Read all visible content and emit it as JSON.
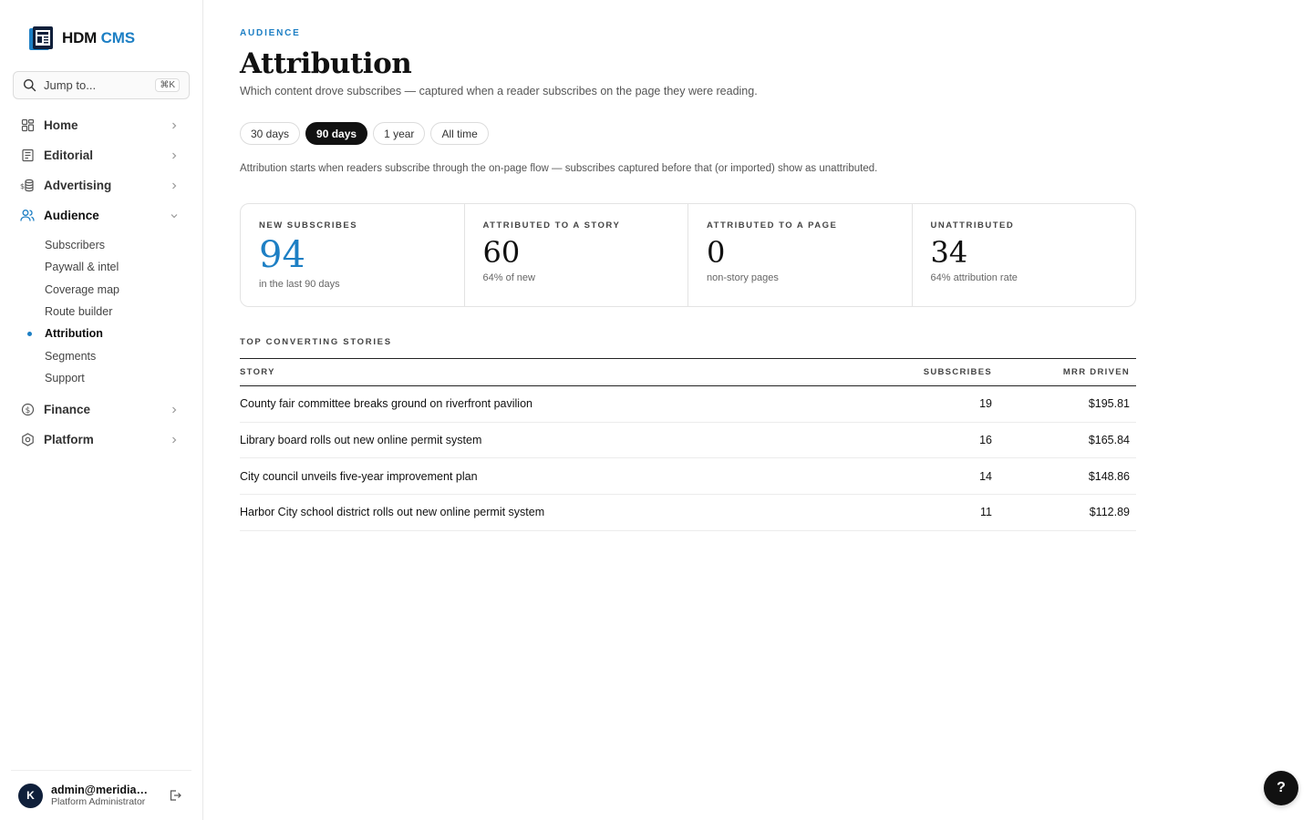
{
  "brand": {
    "name": "HDM",
    "accent": "CMS"
  },
  "search": {
    "label": "Jump to...",
    "shortcut": "⌘K"
  },
  "nav": {
    "home": "Home",
    "editorial": "Editorial",
    "advertising": "Advertising",
    "audience": "Audience",
    "audience_items": [
      "Subscribers",
      "Paywall & intel",
      "Coverage map",
      "Route builder",
      "Attribution",
      "Segments",
      "Support"
    ],
    "finance": "Finance",
    "platform": "Platform"
  },
  "user": {
    "email": "admin@meridian.n...",
    "role": "Platform Administrator",
    "initial": "K"
  },
  "page": {
    "eyebrow": "AUDIENCE",
    "title": "Attribution",
    "subtitle": "Which content drove subscribes — captured when a reader subscribes on the page they were reading.",
    "note": "Attribution starts when readers subscribe through the on-page flow — subscribes captured before that (or imported) show as unattributed."
  },
  "ranges": [
    "30 days",
    "90 days",
    "1 year",
    "All time"
  ],
  "active_range": "90 days",
  "stats": [
    {
      "label": "NEW SUBSCRIBES",
      "value": "94",
      "sub": "in the last 90 days"
    },
    {
      "label": "ATTRIBUTED TO A STORY",
      "value": "60",
      "sub": "64% of new"
    },
    {
      "label": "ATTRIBUTED TO A PAGE",
      "value": "0",
      "sub": "non-story pages"
    },
    {
      "label": "UNATTRIBUTED",
      "value": "34",
      "sub": "64% attribution rate"
    }
  ],
  "top_stories": {
    "heading": "TOP CONVERTING STORIES",
    "columns": [
      "STORY",
      "SUBSCRIBES",
      "MRR DRIVEN"
    ],
    "rows": [
      {
        "story": "County fair committee breaks ground on riverfront pavilion",
        "subscribes": "19",
        "mrr": "$195.81"
      },
      {
        "story": "Library board rolls out new online permit system",
        "subscribes": "16",
        "mrr": "$165.84"
      },
      {
        "story": "City council unveils five-year improvement plan",
        "subscribes": "14",
        "mrr": "$148.86"
      },
      {
        "story": "Harbor City school district rolls out new online permit system",
        "subscribes": "11",
        "mrr": "$112.89"
      }
    ]
  },
  "help_label": "?",
  "colors": {
    "accent": "#1d7fc4",
    "dark": "#111111",
    "avatar": "#0f1f3a"
  }
}
